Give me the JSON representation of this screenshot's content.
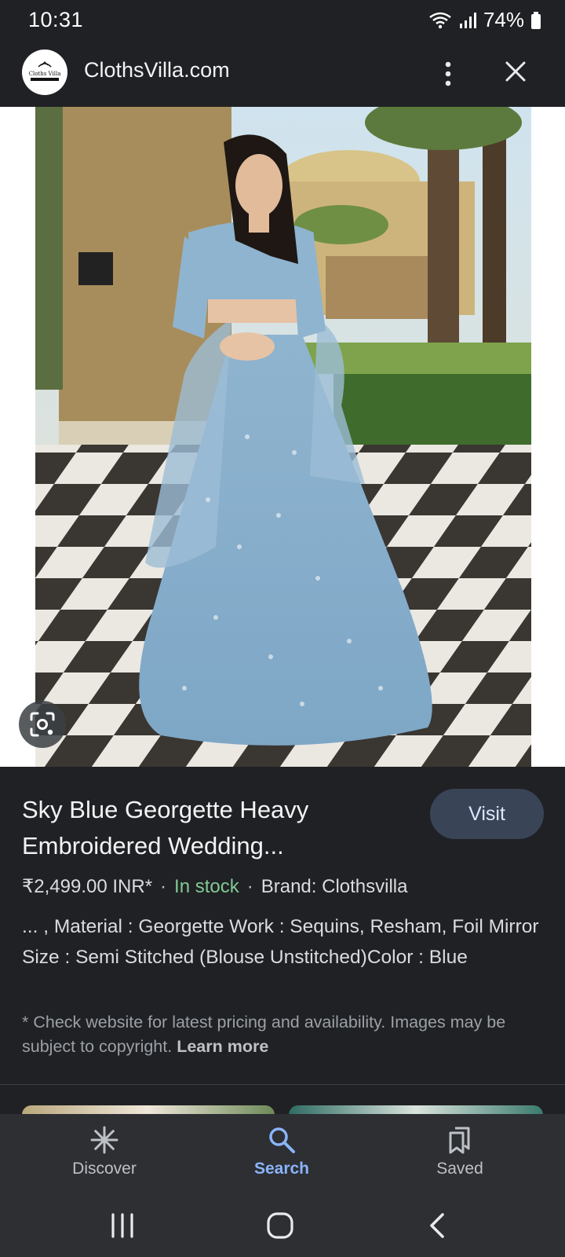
{
  "status": {
    "time": "10:31",
    "battery": "74%"
  },
  "header": {
    "site": "ClothsVilla.com",
    "logo_text": "Cloths Villa"
  },
  "product": {
    "title": "Sky Blue Georgette Heavy Embroidered Wedding...",
    "visit_label": "Visit",
    "price": "₹2,499.00 INR*",
    "stock": "In stock",
    "brand": "Brand: Clothsvilla",
    "description": "... , Material : Georgette Work : Sequins, Resham, Foil Mirror Size : Semi Stitched (Blouse Unstitched)Color : Blue",
    "disclaimer": "* Check website for latest pricing and availability. Images may be subject to copyright.",
    "learn_more": "Learn more"
  },
  "nav": {
    "items": [
      {
        "label": "Discover",
        "icon": "asterisk-icon"
      },
      {
        "label": "Search",
        "icon": "search-icon"
      },
      {
        "label": "Saved",
        "icon": "bookmarks-icon"
      }
    ]
  },
  "colors": {
    "accent": "#8ab4f8",
    "stock": "#81c995",
    "visit_bg": "#394457"
  }
}
